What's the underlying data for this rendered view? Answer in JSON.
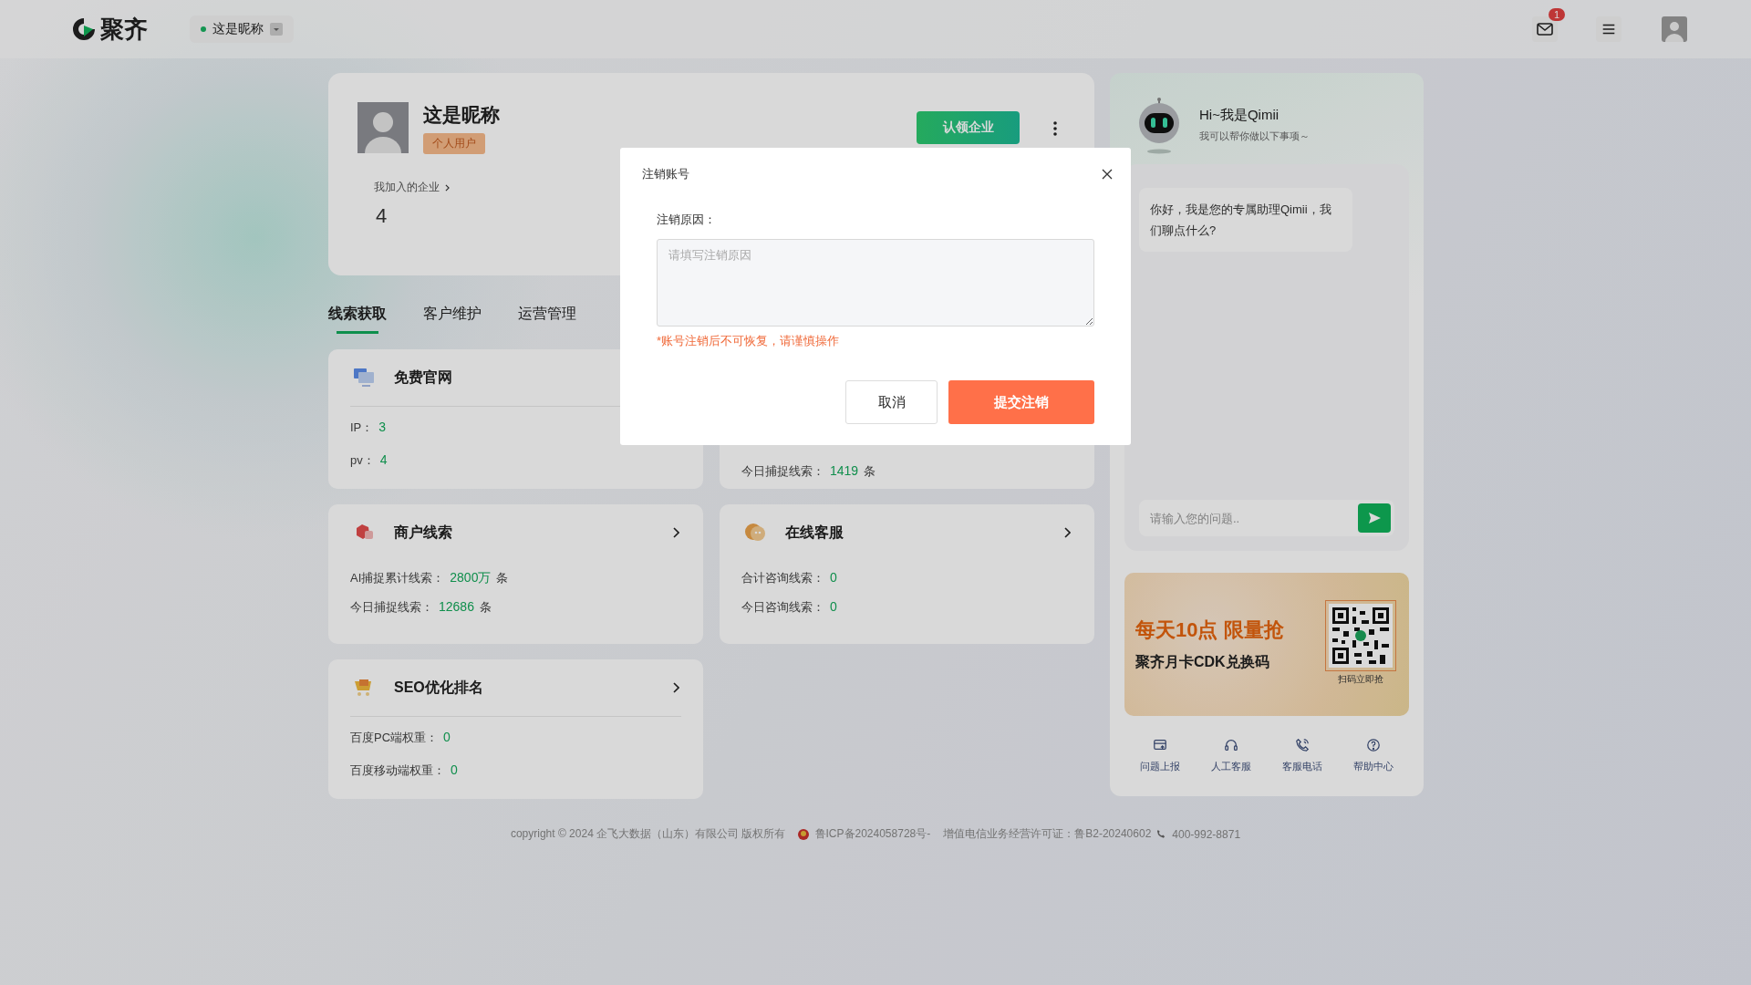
{
  "header": {
    "logo_text": "聚齐",
    "user_switch": {
      "name": "这是昵称",
      "online": true
    },
    "mail_badge": "1"
  },
  "profile": {
    "name": "这是昵称",
    "tag": "个人用户",
    "joined_label": "我加入的企业",
    "joined_count": "4",
    "claim_button": "认领企业"
  },
  "tabs": [
    {
      "label": "线索获取",
      "selected": true
    },
    {
      "label": "客户维护",
      "selected": false
    },
    {
      "label": "运营管理",
      "selected": false
    }
  ],
  "cards": [
    {
      "title": "免费官网",
      "kind": "monitor",
      "arrow": false,
      "divider": true,
      "stats": [
        {
          "label": "IP：",
          "value": "3"
        },
        {
          "label": "pv：",
          "value": "4"
        }
      ]
    },
    {
      "stats": [
        {
          "label": "今日捕捉线索：",
          "value": "1419",
          "unit": "条"
        }
      ]
    },
    {
      "title": "商户线索",
      "kind": "gem",
      "arrow": true,
      "divider": false,
      "stats": [
        {
          "label": "AI捕捉累计线索：",
          "value": "2800万",
          "unit": "条"
        },
        {
          "label": "今日捕捉线索：",
          "value": "12686",
          "unit": "条"
        }
      ]
    },
    {
      "title": "在线客服",
      "kind": "chat",
      "arrow": true,
      "divider": false,
      "stats": [
        {
          "label": "合计咨询线索：",
          "value": "0"
        },
        {
          "label": "今日咨询线索：",
          "value": "0"
        }
      ]
    },
    {
      "title": "SEO优化排名",
      "kind": "cart",
      "arrow": true,
      "divider": true,
      "stats": [
        {
          "label": "百度PC端权重：",
          "value": "0"
        },
        {
          "label": "百度移动端权重：",
          "value": "0"
        }
      ]
    }
  ],
  "assistant": {
    "title": "Hi~我是Qimii",
    "subtitle": "我可以帮你做以下事项～",
    "message": "你好，我是您的专属助理Qimii，我们聊点什么?",
    "input_placeholder": "请输入您的问题.."
  },
  "promo": {
    "headline": "每天10点 限量抢",
    "subline": "聚齐月卡CDK兑换码",
    "qr_caption": "扫码立即抢"
  },
  "shortcuts": [
    {
      "label": "问题上报",
      "kind": "report"
    },
    {
      "label": "人工客服",
      "kind": "headset"
    },
    {
      "label": "客服电话",
      "kind": "phone"
    },
    {
      "label": "帮助中心",
      "kind": "help"
    }
  ],
  "footer": {
    "copyright": "copyright © 2024 企飞大数据（山东）有限公司 版权所有",
    "icp": "鲁ICP备2024058728号-",
    "license": "增值电信业务经营许可证：鲁B2-20240602",
    "phone": "400-992-8871"
  },
  "modal": {
    "title": "注销账号",
    "field_label": "注销原因：",
    "placeholder": "请填写注销原因",
    "warning": "*账号注销后不可恢复，请谨慎操作",
    "cancel": "取消",
    "submit": "提交注销"
  }
}
